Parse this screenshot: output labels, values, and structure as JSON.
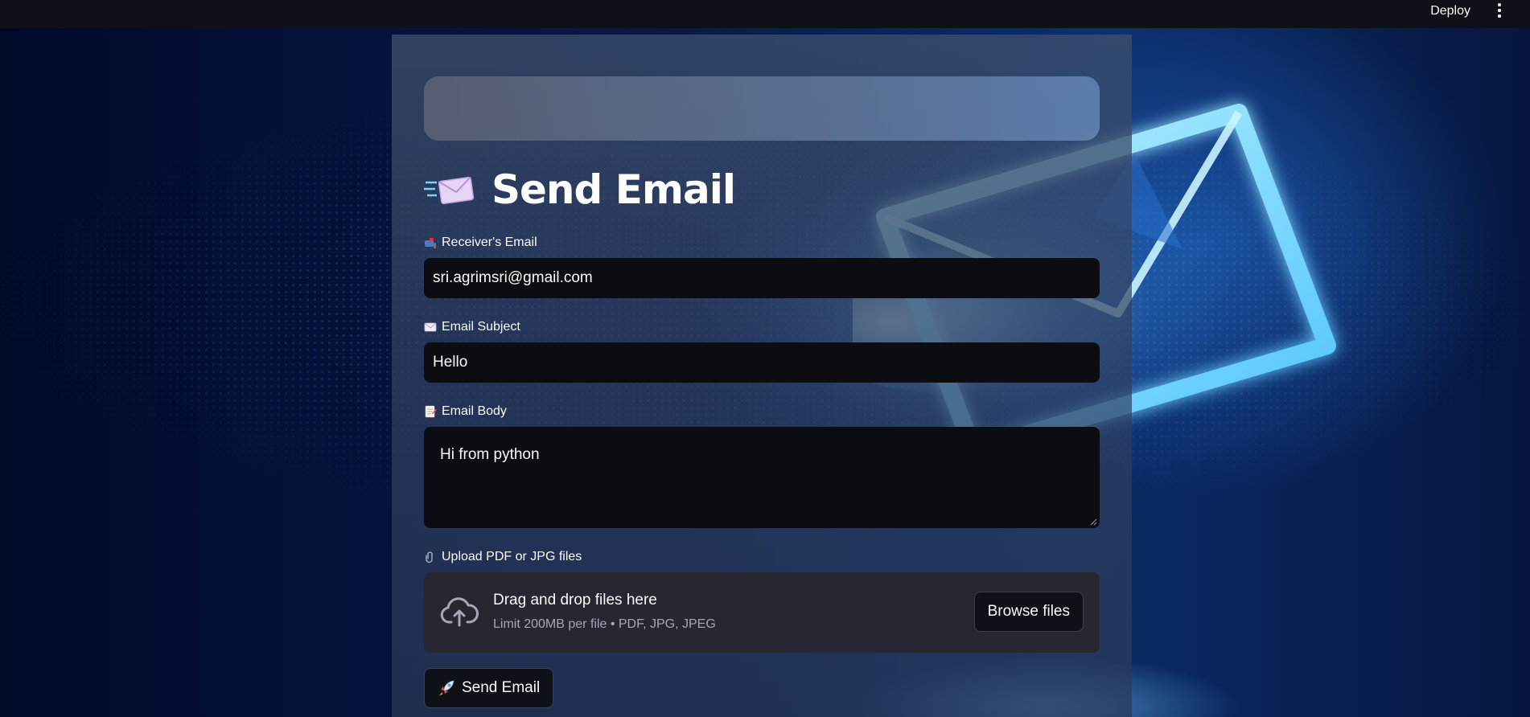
{
  "header": {
    "deploy_label": "Deploy",
    "menu_icon": "kebab-menu-icon"
  },
  "page": {
    "title": "Send Email",
    "title_icon": "flying-envelope-icon"
  },
  "form": {
    "receiver": {
      "label": "Receiver's Email",
      "icon": "mailbox-icon",
      "value": "sri.agrimsri@gmail.com"
    },
    "subject": {
      "label": "Email Subject",
      "icon": "envelope-icon",
      "value": "Hello"
    },
    "body": {
      "label": "Email Body",
      "icon": "memo-icon",
      "value": "Hi from python"
    },
    "upload": {
      "label": "Upload PDF or JPG files",
      "icon": "paperclip-icon",
      "drop_title": "Drag and drop files here",
      "drop_hint": "Limit 200MB per file • PDF, JPG, JPEG",
      "browse_label": "Browse files",
      "cloud_icon": "cloud-upload-icon"
    },
    "submit": {
      "label": "Send Email",
      "icon": "rocket-icon"
    }
  },
  "colors": {
    "header_bg": "#0e1117",
    "input_bg": "#0c0d12",
    "uploader_bg": "#262730",
    "text": "#fafafa",
    "muted_text": "#a3a8b8"
  }
}
